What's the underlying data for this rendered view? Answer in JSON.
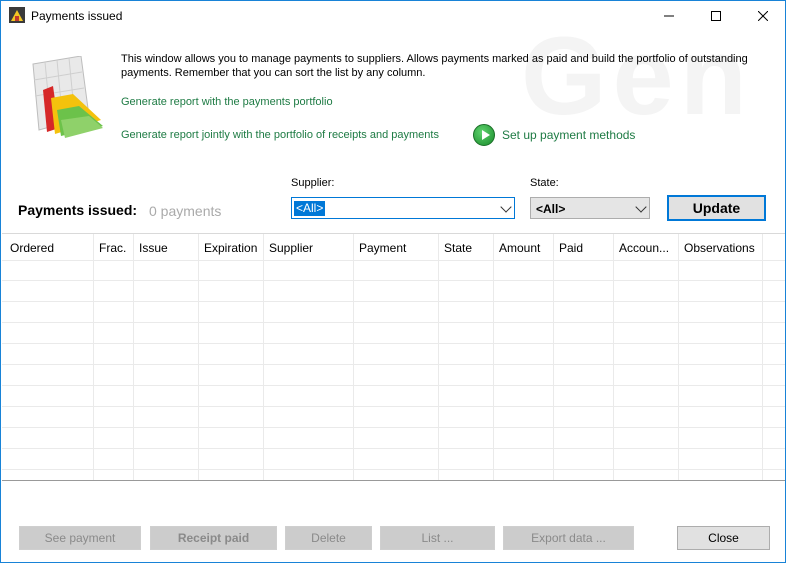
{
  "window": {
    "title": "Payments issued"
  },
  "intro": {
    "description": "This window allows you to manage payments to suppliers. Allows payments marked as paid and build the portfolio of outstanding payments. Remember that you can sort the list by any column.",
    "link_portfolio": "Generate report with the payments portfolio",
    "link_joint": "Generate report jointly with the portfolio of receipts and payments",
    "link_setup": "Set up payment methods"
  },
  "filters": {
    "supplier_label": "Supplier:",
    "supplier_value": "<All>",
    "state_label": "State:",
    "state_value": "<All>",
    "update_label": "Update"
  },
  "summary": {
    "title": "Payments issued:",
    "count": "0 payments"
  },
  "table": {
    "columns": [
      "Ordered",
      "Frac.",
      "Issue",
      "Expiration",
      "Supplier",
      "Payment",
      "State",
      "Amount",
      "Paid",
      "Accoun...",
      "Observations"
    ]
  },
  "buttons": {
    "see_payment": "See payment",
    "receipt_paid": "Receipt paid",
    "delete": "Delete",
    "list": "List ...",
    "export": "Export data ...",
    "close": "Close"
  },
  "colors": {
    "accent": "#0078d7",
    "link": "#1e7b44"
  }
}
